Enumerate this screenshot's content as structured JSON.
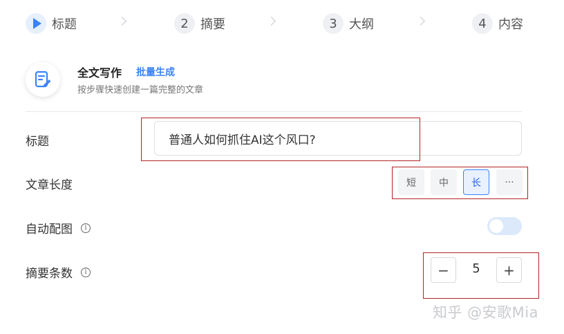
{
  "steps": [
    {
      "num": "",
      "label": "标题"
    },
    {
      "num": "2",
      "label": "摘要"
    },
    {
      "num": "3",
      "label": "大纲"
    },
    {
      "num": "4",
      "label": "内容"
    }
  ],
  "header": {
    "title": "全文写作",
    "batch_link": "批量生成",
    "subtitle": "按步骤快速创建一篇完整的文章"
  },
  "form": {
    "title_label": "标题",
    "title_value": "普通人如何抓住AI这个风口?",
    "length_label": "文章长度",
    "length_options": [
      "短",
      "中",
      "长",
      "···"
    ],
    "length_selected": "长",
    "auto_image_label": "自动配图",
    "auto_image_enabled": false,
    "summary_count_label": "摘要条数",
    "summary_count_value": "5",
    "minus": "−",
    "plus": "+",
    "info_glyph": "i"
  },
  "watermark": "知乎 @安歌Mia",
  "colors": {
    "accent": "#3b82f6",
    "annotation": "#b22222"
  }
}
